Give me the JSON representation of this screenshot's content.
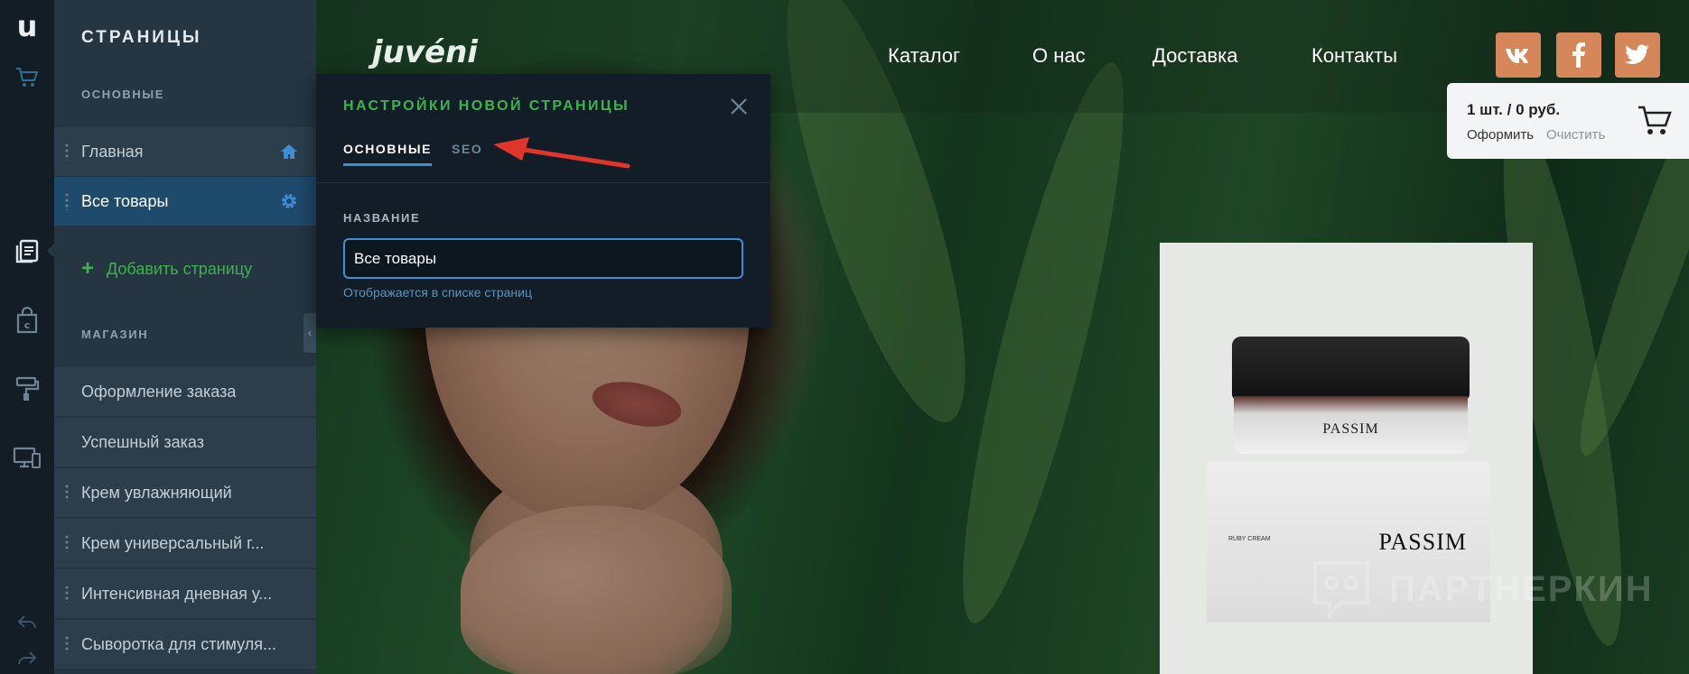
{
  "rail": {
    "logo": "u",
    "icons": [
      "cart-icon",
      "pages-icon",
      "shop-bag-icon",
      "paint-roller-icon",
      "devices-icon",
      "undo-icon",
      "redo-icon"
    ]
  },
  "sidebar": {
    "title": "СТРАНИЦЫ",
    "section_main": "ОСНОВНЫЕ",
    "main_items": [
      {
        "label": "Главная",
        "icon": "home-icon"
      },
      {
        "label": "Все товары",
        "icon": "gear-icon"
      }
    ],
    "add_label": "Добавить страницу",
    "section_shop": "МАГАЗИН",
    "shop_items": [
      {
        "label": "Оформление заказа"
      },
      {
        "label": "Успешный заказ"
      },
      {
        "label": "Крем увлажняющий"
      },
      {
        "label": "Крем универсальный г..."
      },
      {
        "label": "Интенсивная дневная у..."
      },
      {
        "label": "Сыворотка для стимуля..."
      }
    ]
  },
  "site": {
    "brand": "juvéni",
    "nav": [
      "Каталог",
      "О нас",
      "Доставка",
      "Контакты"
    ],
    "social": [
      "vk-icon",
      "facebook-icon",
      "twitter-icon"
    ],
    "cart": {
      "summary": "1 шт. / 0 руб.",
      "checkout": "Оформить",
      "clear": "Очистить"
    },
    "product": {
      "jar_label": "PASSIM",
      "box_brand": "PASSIM",
      "box_small": "RUBY CREAM"
    },
    "watermark": "ПАРТНЕРКИН"
  },
  "modal": {
    "title": "НАСТРОЙКИ НОВОЙ СТРАНИЦЫ",
    "tabs": [
      {
        "label": "ОСНОВНЫЕ",
        "active": true
      },
      {
        "label": "SEO",
        "active": false
      }
    ],
    "field_label": "НАЗВАНИЕ",
    "field_value": "Все товары",
    "field_hint": "Отображается в списке страниц"
  },
  "colors": {
    "accent_green": "#3bb54a",
    "accent_blue": "#3e8ed6",
    "social_orange": "#d6875a",
    "arrow_red": "#e0352b"
  }
}
